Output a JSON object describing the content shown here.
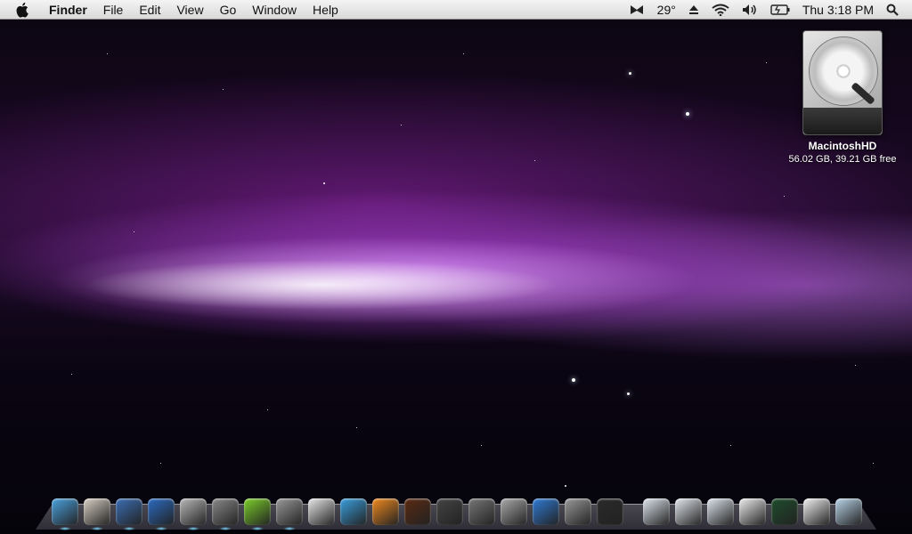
{
  "menubar": {
    "app_name": "Finder",
    "menus": [
      "File",
      "Edit",
      "View",
      "Go",
      "Window",
      "Help"
    ],
    "temperature": "29°",
    "clock": "Thu 3:18 PM"
  },
  "desktop": {
    "drive_name": "MacintoshHD",
    "drive_info": "56.02 GB, 39.21 GB free"
  },
  "dock": {
    "items": [
      {
        "name": "finder-icon",
        "color": "#4aa3e0"
      },
      {
        "name": "mail-icon",
        "color": "#d8d0c4"
      },
      {
        "name": "safari-icon",
        "color": "#3b6fb6"
      },
      {
        "name": "firefox-icon",
        "color": "#2b6cc4"
      },
      {
        "name": "headphones-icon",
        "color": "#b9b9b9"
      },
      {
        "name": "system-preferences-icon",
        "color": "#8a8a8a"
      },
      {
        "name": "itunes-icon",
        "color": "#7bcf2a"
      },
      {
        "name": "disk-utility-icon",
        "color": "#9a9a9a"
      },
      {
        "name": "ipad-icon",
        "color": "#e8e8e8"
      },
      {
        "name": "messenger-icon",
        "color": "#3aa0e0"
      },
      {
        "name": "vlc-icon",
        "color": "#f08a1e"
      },
      {
        "name": "snickers-icon",
        "color": "#5a2a12"
      },
      {
        "name": "lamp-icon",
        "color": "#444444"
      },
      {
        "name": "download-icon",
        "color": "#777777"
      },
      {
        "name": "utilities-icon",
        "color": "#aaaaaa"
      },
      {
        "name": "wifi-icon",
        "color": "#2f7bd6"
      },
      {
        "name": "network-icon",
        "color": "#9a9a9a"
      },
      {
        "name": "console-icon",
        "color": "#2a2a2a"
      }
    ],
    "right_items": [
      {
        "name": "folder-icon",
        "color": "#dfe6ee"
      },
      {
        "name": "quicktime-file-icon",
        "color": "#e4e9ef"
      },
      {
        "name": "documents-folder-icon",
        "color": "#dfe6ee"
      },
      {
        "name": "screenshot-icon",
        "color": "#eeeeee"
      },
      {
        "name": "activity-icon",
        "color": "#1e4d2b"
      },
      {
        "name": "window-stack-icon",
        "color": "#f2f2f2"
      },
      {
        "name": "trash-icon",
        "color": "#b8d4e8"
      }
    ]
  }
}
